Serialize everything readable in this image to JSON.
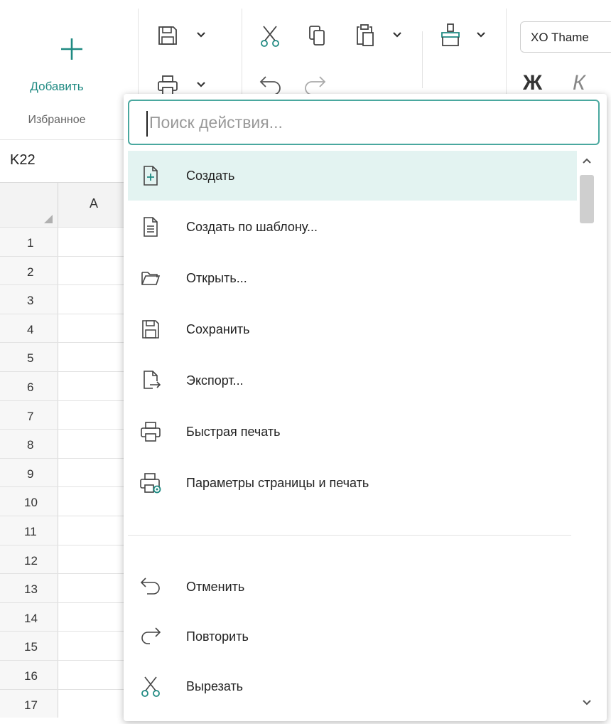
{
  "ribbon": {
    "add_label": "Добавить",
    "favorites_label": "Избранное",
    "icons": [
      "save-icon",
      "print-icon",
      "cut-icon",
      "copy-icon",
      "paste-icon",
      "undo-icon",
      "redo-icon",
      "format-painter-icon"
    ],
    "theme_value": "XO Thame",
    "bold_glyph": "Ж",
    "italic_glyph": "К",
    "accent_color": "#1f8a82"
  },
  "sheet": {
    "cell_ref": "K22",
    "column_header": "A",
    "row_numbers": [
      "1",
      "2",
      "3",
      "4",
      "5",
      "6",
      "7",
      "8",
      "9",
      "10",
      "11",
      "12",
      "13",
      "14",
      "15",
      "16",
      "17"
    ]
  },
  "action_search": {
    "placeholder": "Поиск действия...",
    "value": "",
    "items": [
      {
        "label": "Создать",
        "icon": "new-document-icon",
        "active": true
      },
      {
        "label": "Создать по шаблону...",
        "icon": "template-document-icon"
      },
      {
        "label": "Открыть...",
        "icon": "open-folder-icon"
      },
      {
        "label": "Сохранить",
        "icon": "save-icon"
      },
      {
        "label": "Экспорт...",
        "icon": "export-icon"
      },
      {
        "label": "Быстрая печать",
        "icon": "print-icon"
      },
      {
        "label": "Параметры страницы и печать",
        "icon": "page-setup-print-icon"
      },
      {
        "label": "Отменить",
        "icon": "undo-icon"
      },
      {
        "label": "Повторить",
        "icon": "redo-icon"
      },
      {
        "label": "Вырезать",
        "icon": "cut-icon"
      }
    ],
    "highlight_color": "#e3f3f1",
    "border_color": "#4aa89f"
  }
}
